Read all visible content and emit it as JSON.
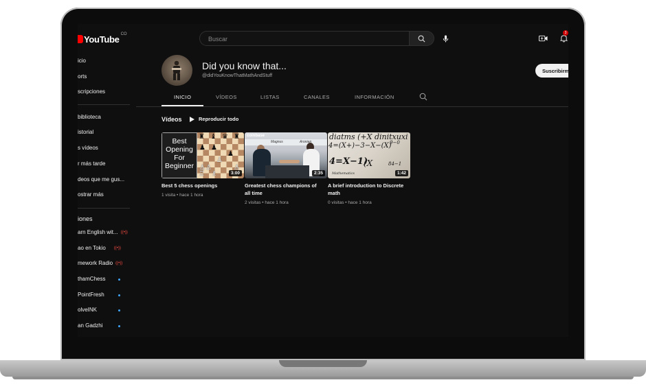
{
  "topbar": {
    "logo_text": "YouTube",
    "logo_sup": "CO",
    "search_placeholder": "Buscar",
    "notification_count": "3"
  },
  "sidebar": {
    "items": [
      {
        "label": "icio"
      },
      {
        "label": "orts"
      },
      {
        "label": "scripciones"
      },
      {
        "label": "biblioteca"
      },
      {
        "label": "istorial"
      },
      {
        "label": "s vídeos"
      },
      {
        "label": "r más tarde"
      },
      {
        "label": "deos que me gus..."
      },
      {
        "label": "ostrar más"
      }
    ],
    "subs_heading": "iones",
    "subscriptions": [
      {
        "label": "arn English wit...",
        "status": "live"
      },
      {
        "label": "ao en Tokio",
        "status": "live"
      },
      {
        "label": "mework Radio",
        "status": "live"
      },
      {
        "label": "thamChess",
        "status": "new"
      },
      {
        "label": "PointFresh",
        "status": "new"
      },
      {
        "label": "olveINK",
        "status": "new"
      },
      {
        "label": "an Gadzhi",
        "status": "new"
      }
    ]
  },
  "channel": {
    "name": "Did you know that...",
    "handle": "@didYouKnowThatMathAndStuff",
    "subscribe_label": "Suscribirme"
  },
  "tabs": [
    {
      "label": "INICIO",
      "active": true
    },
    {
      "label": "VÍDEOS",
      "active": false
    },
    {
      "label": "LISTAS",
      "active": false
    },
    {
      "label": "CANALES",
      "active": false
    },
    {
      "label": "INFORMACIÓN",
      "active": false
    }
  ],
  "videos_section": {
    "title": "Vídeos",
    "play_all_label": "Reproducir todo"
  },
  "videos": [
    {
      "title": "Best 5 chess openings",
      "meta": "1 visita • hace 1 hora",
      "duration": "3:00",
      "thumb_text": [
        "Best",
        "Opening",
        "For",
        "Beginner"
      ]
    },
    {
      "title": "Greatest chess champions of all time",
      "meta": "2 visitas • hace 1 hora",
      "duration": "2:35",
      "thumb_logo": "coinbase",
      "thumb_banner": [
        "Magnus",
        "Aronian"
      ]
    },
    {
      "title": "A brief introduction to Discrete math",
      "meta": "0 visitas • hace 1 hora",
      "duration": "1:42"
    }
  ],
  "colors": {
    "brand": "#ff0000",
    "background": "#0f0f0f",
    "text_primary": "#f1f1f1",
    "text_secondary": "#aaaaaa",
    "live": "#ff4e45",
    "new_dot": "#3ea6ff"
  }
}
